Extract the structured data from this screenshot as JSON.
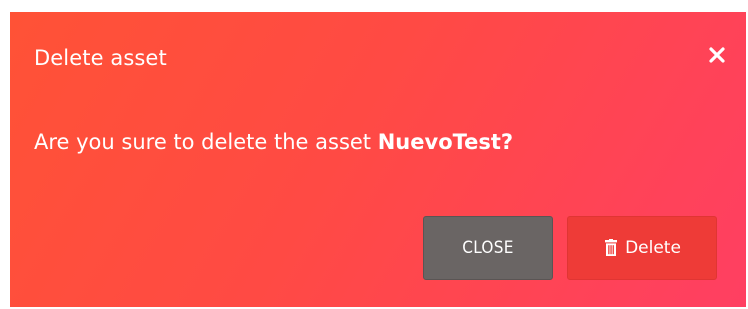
{
  "dialog": {
    "title": "Delete asset",
    "message_prefix": "Are you sure to delete the asset ",
    "asset_name": "NuevoTest?",
    "close_icon": "close-icon",
    "buttons": {
      "close_label": "CLOSE",
      "delete_label": "Delete",
      "delete_icon": "trash-icon"
    },
    "colors": {
      "gradient_start": "#ff5236",
      "gradient_end": "#ff3f62",
      "close_button": "#6a6564",
      "delete_button": "#ee3b37"
    }
  }
}
